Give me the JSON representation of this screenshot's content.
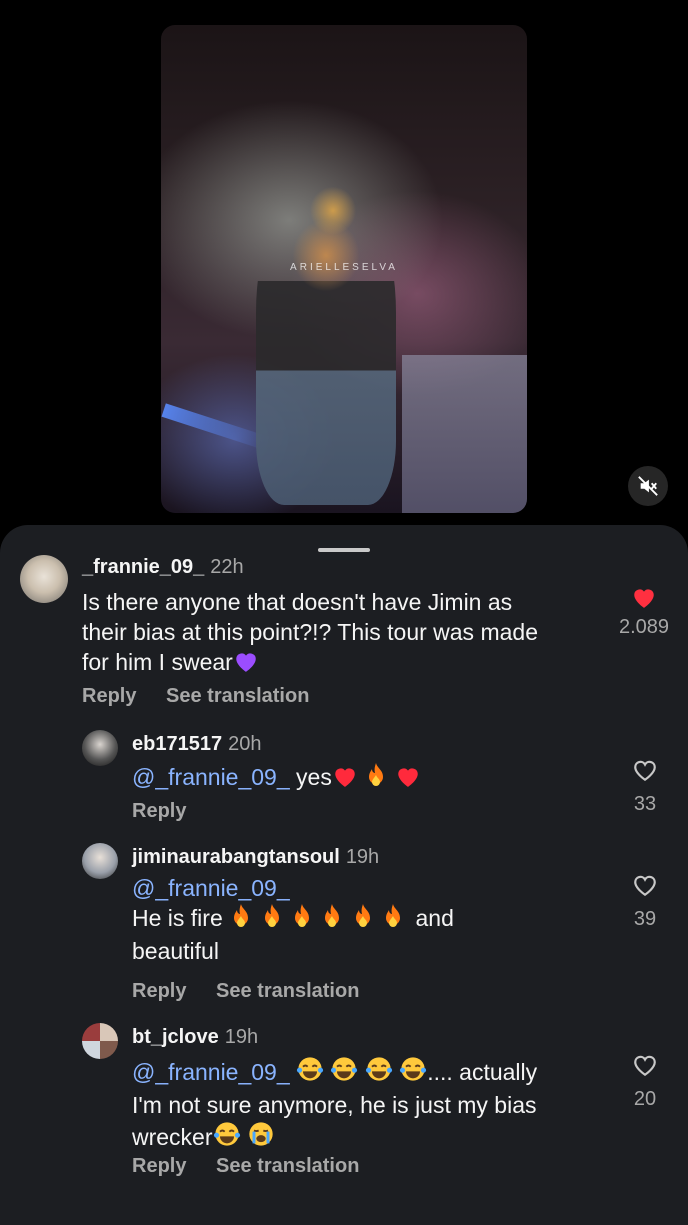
{
  "video": {
    "watermark": "ARIELLESELVA",
    "mute_icon": "speaker-muted-icon"
  },
  "comments": [
    {
      "username": "_frannie_09_",
      "time": "22h",
      "text": "Is there anyone that doesn't have Jimin as their bias at this point?!? This tour was made for him I swear",
      "text_line1": "Is there anyone that doesn't have Jimin as",
      "text_line2": "their bias at this point?!? This tour was made",
      "text_line3": "for him I swear",
      "likes": "2.089",
      "liked": true,
      "reply_label": "Reply",
      "translate_label": "See translation"
    },
    {
      "username": "eb171517",
      "time": "20h",
      "mention": "@_frannie_09_",
      "text": "yes",
      "likes": "33",
      "liked": false,
      "reply_label": "Reply"
    },
    {
      "username": "jiminaurabangtansoul",
      "time": "19h",
      "mention": "@_frannie_09_",
      "text_a": "He is fire",
      "text_b": "and",
      "text_c": "beautiful",
      "likes": "39",
      "liked": false,
      "reply_label": "Reply",
      "translate_label": "See translation"
    },
    {
      "username": "bt_jclove",
      "time": "19h",
      "mention": "@_frannie_09_",
      "text_a": ".... actually",
      "text_b": "I'm not sure anymore, he is just my bias",
      "text_c": "wrecker",
      "likes": "20",
      "liked": false,
      "reply_label": "Reply",
      "translate_label": "See translation"
    }
  ],
  "colors": {
    "like_red": "#ff3040",
    "mention_blue": "#8ab4ff",
    "sheet_bg": "#1c1e22"
  }
}
